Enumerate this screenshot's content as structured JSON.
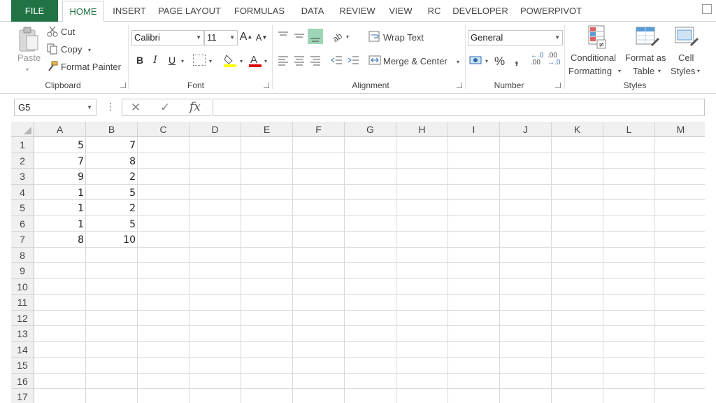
{
  "tabs": [
    {
      "id": "file",
      "label": "FILE"
    },
    {
      "id": "home",
      "label": "HOME"
    },
    {
      "id": "insert",
      "label": "INSERT"
    },
    {
      "id": "page-layout",
      "label": "PAGE LAYOUT"
    },
    {
      "id": "formulas",
      "label": "FORMULAS"
    },
    {
      "id": "data",
      "label": "DATA"
    },
    {
      "id": "review",
      "label": "REVIEW"
    },
    {
      "id": "view",
      "label": "VIEW"
    },
    {
      "id": "rc",
      "label": "RC"
    },
    {
      "id": "developer",
      "label": "DEVELOPER"
    },
    {
      "id": "powerpivot",
      "label": "POWERPIVOT"
    }
  ],
  "clipboard": {
    "paste": "Paste",
    "cut": "Cut",
    "copy": "Copy",
    "format_painter": "Format Painter",
    "group_label": "Clipboard"
  },
  "font": {
    "name": "Calibri",
    "size": "11",
    "bold": "B",
    "italic": "I",
    "underline": "U",
    "group_label": "Font",
    "fill_color": "#ffff00",
    "font_color": "#ff0000"
  },
  "alignment": {
    "wrap_text": "Wrap Text",
    "merge_center": "Merge & Center",
    "group_label": "Alignment"
  },
  "number": {
    "format": "General",
    "percent": "%",
    "comma": ",",
    "inc_decimal": ".00",
    "dec_decimal": ".00",
    "group_label": "Number"
  },
  "styles": {
    "conditional_1": "Conditional",
    "conditional_2": "Formatting",
    "format_table_1": "Format as",
    "format_table_2": "Table",
    "cell_styles_1": "Cell",
    "cell_styles_2": "Styles",
    "group_label": "Styles"
  },
  "formula_bar": {
    "name_box": "G5",
    "fx": "fx",
    "content": ""
  },
  "sheet": {
    "columns": [
      "A",
      "B",
      "C",
      "D",
      "E",
      "F",
      "G",
      "H",
      "I",
      "J",
      "K",
      "L",
      "M"
    ],
    "rows": [
      "1",
      "2",
      "3",
      "4",
      "5",
      "6",
      "7",
      "8",
      "9",
      "10",
      "11",
      "12",
      "13",
      "14",
      "15",
      "16",
      "17"
    ],
    "cells": [
      [
        "5",
        "7"
      ],
      [
        "7",
        "8"
      ],
      [
        "9",
        "2"
      ],
      [
        "1",
        "5"
      ],
      [
        "1",
        "2"
      ],
      [
        "1",
        "5"
      ],
      [
        "8",
        "10"
      ]
    ]
  },
  "colors": {
    "accent": "#217346",
    "grid_header_bg": "#f0f0f0",
    "gridline": "#dadada"
  }
}
